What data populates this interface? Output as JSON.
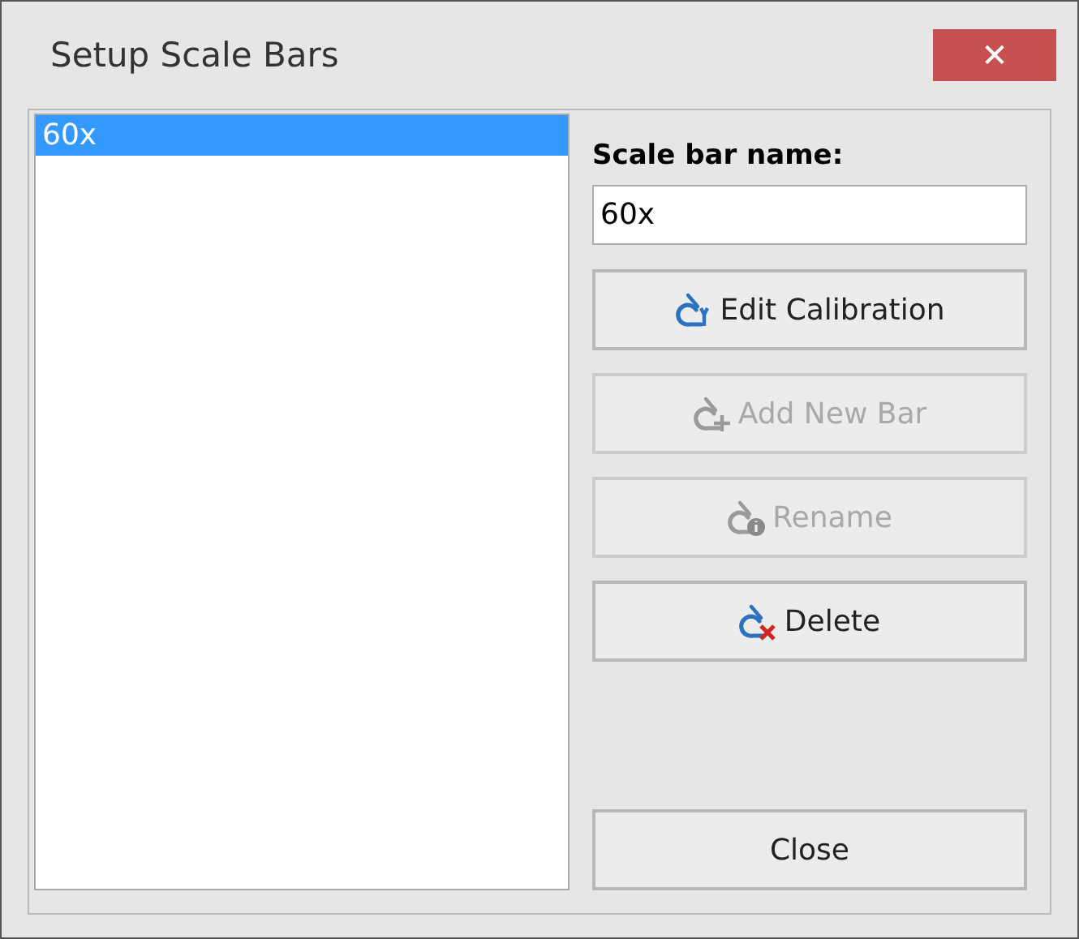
{
  "window": {
    "title": "Setup Scale Bars",
    "close_label": "✕"
  },
  "list": {
    "items": [
      {
        "label": "60x",
        "selected": true
      }
    ]
  },
  "name_field": {
    "label": "Scale bar name:",
    "value": "60x"
  },
  "buttons": [
    {
      "label": "Edit Calibration",
      "kind": "edit",
      "disabled": false
    },
    {
      "label": "Add New Bar",
      "kind": "add",
      "disabled": true
    },
    {
      "label": "Rename",
      "kind": "rename",
      "disabled": true
    },
    {
      "label": "Delete",
      "kind": "delete",
      "disabled": false
    }
  ],
  "close_button": {
    "label": "Close"
  }
}
